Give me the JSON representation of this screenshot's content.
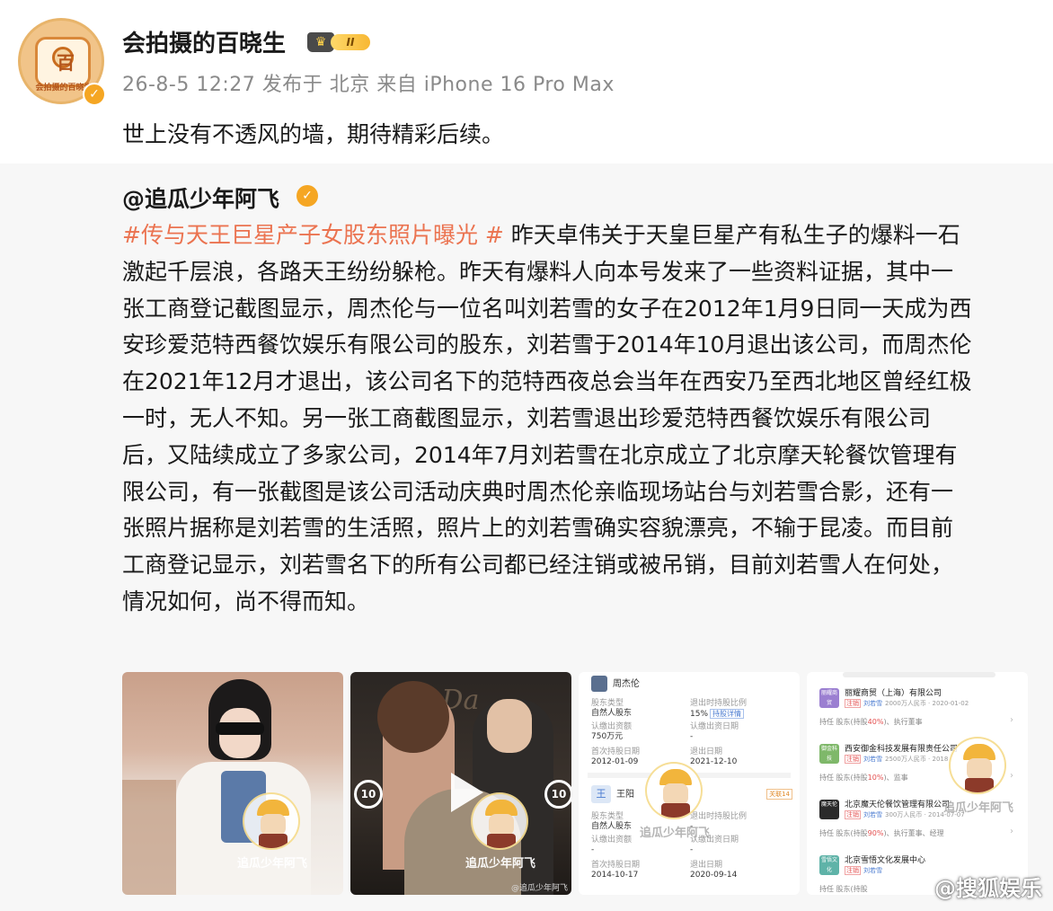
{
  "post": {
    "author": "会拍摄的百晓生",
    "avatar_char": "百",
    "avatar_caption": "会拍摄的百晓生",
    "level_badge": "II",
    "meta": "26-8-5 12:27  发布于 北京  来自 iPhone 16 Pro Max",
    "text": "世上没有不透风的墙，期待精彩后续。"
  },
  "repost": {
    "author": "@追瓜少年阿飞",
    "hashtag": "#传与天王巨星产子女股东照片曝光 #",
    "lines": [
      " 昨天卓伟关于天皇巨星产有私生子的爆料一石",
      "激起千层浪，各路天王纷纷躲枪。昨天有爆料人向本号发来了一些资料证据，其中一",
      "张工商登记截图显示，周杰伦与一位名叫刘若雪的女子在2012年1月9日同一天成为西",
      "安珍爱范特西餐饮娱乐有限公司的股东，刘若雪于2014年10月退出该公司，而周杰伦",
      "在2021年12月才退出，该公司名下的范特西夜总会当年在西安乃至西北地区曾经红极",
      "一时，无人不知。另一张工商截图显示，刘若雪退出珍爱范特西餐饮娱乐有限公司",
      "后，又陆续成立了多家公司，2014年7月刘若雪在北京成立了北京摩天轮餐饮管理有",
      "限公司，有一张截图是该公司活动庆典时周杰伦亲临现场站台与刘若雪合影，还有一",
      "张照片据称是刘若雪的生活照，照片上的刘若雪确实容貌漂亮，不输于昆凌。而目前",
      "工商登记显示，刘若雪名下的所有公司都已经注销或被吊销，目前刘若雪人在何处，",
      "情况如何，尚不得而知。"
    ]
  },
  "watermark": {
    "label": "追瓜少年阿飞",
    "video_caption": "@追瓜少年阿飞",
    "corner": "@搜狐娱乐"
  },
  "video": {
    "rewind_label": "10",
    "forward_label": "10",
    "bg_text": "I Da"
  },
  "record_card": {
    "person1_name": "周杰伦",
    "p1_type_label": "股东类型",
    "p1_type_value": "自然人股东",
    "p1_ratio_label": "退出时持股比例",
    "p1_ratio_value": "15%",
    "p1_ratio_link": "持股详情",
    "p1_paid_label": "认缴出资额",
    "p1_paid_value": "750万元",
    "p1_actual_label": "认缴出资日期",
    "p1_actual_value": "-",
    "p1_start_label": "首次持股日期",
    "p1_start_value": "2012-01-09",
    "p1_end_label": "退出日期",
    "p1_end_value": "2021-12-10",
    "person2_avatar": "王",
    "person2_name": "王阳",
    "person2_tag": "关联14",
    "p2_type_label": "股东类型",
    "p2_type_value": "自然人股东",
    "p2_ratio_label": "退出时持股比例",
    "p2_ratio_value": "-",
    "p2_paid_label": "认缴出资额",
    "p2_paid_value": "-",
    "p2_actual_label": "认缴出资日期",
    "p2_actual_value": "-",
    "p2_start_label": "首次持股日期",
    "p2_start_value": "2014-10-17",
    "p2_end_label": "退出日期",
    "p2_end_value": "2020-09-14"
  },
  "company_card": {
    "companies": [
      {
        "logo": "丽耀商贸",
        "color": "#9b7fd1",
        "name": "丽耀商贸（上海）有限公司",
        "status": "注销",
        "person": "刘若雪",
        "detail": "2000万人民币 · 2020-01-02",
        "role_prefix": "持任 股东(持股",
        "role_pct": "40%",
        "role_suffix": ")、执行董事"
      },
      {
        "logo": "御金科技",
        "color": "#7fb86a",
        "name": "西安御金科技发展有限责任公司",
        "status": "注销",
        "person": "刘若雪",
        "detail": "2500万人民币 · 2018",
        "role_prefix": "持任 股东(持股",
        "role_pct": "10%",
        "role_suffix": ")、监事"
      },
      {
        "logo": "魔天伦",
        "color": "#2a2a2a",
        "name": "北京魔天伦餐饮管理有限公司",
        "status": "注销",
        "person": "刘若雪",
        "detail": "300万人民币 · 2014-07-07",
        "role_prefix": "持任 股东(持股",
        "role_pct": "90%",
        "role_suffix": ")、执行董事、经理"
      },
      {
        "logo": "雪悟文化",
        "color": "#5fb3a8",
        "name": "北京雪悟文化发展中心",
        "status": "注销",
        "person": "刘若雪",
        "detail": "",
        "role_prefix": "持任 股东(持股",
        "role_pct": "",
        "role_suffix": ""
      }
    ]
  }
}
